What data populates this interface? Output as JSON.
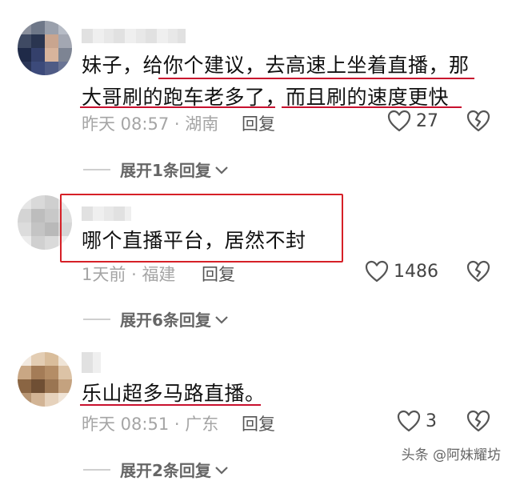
{
  "comments": [
    {
      "text_lines": [
        "妹子，给你个建议，去高速上坐着直播，那",
        "大哥刷的跑车老多了，而且刷的速度更快"
      ],
      "time": "昨天 08:57",
      "location": "湖南",
      "reply_label": "回复",
      "likes": "27",
      "expand_label": "展开1条回复"
    },
    {
      "text_lines": [
        "哪个直播平台，居然不封"
      ],
      "time": "1天前",
      "location": "福建",
      "reply_label": "回复",
      "likes": "1486",
      "expand_label": "展开6条回复"
    },
    {
      "text_lines": [
        "乐山超多马路直播。"
      ],
      "time": "昨天 08:51",
      "location": "广东",
      "reply_label": "回复",
      "likes": "3",
      "expand_label": "展开2条回复"
    }
  ],
  "meta_separator": "·",
  "watermark": "头条 @阿妹耀坊",
  "icons": {
    "like": "heart-outline-icon",
    "dislike": "broken-heart-icon",
    "expand": "chevron-down-icon"
  },
  "colors": {
    "annotation_red": "#c8102e",
    "meta_gray": "#a5a5a5",
    "text": "#111111"
  }
}
